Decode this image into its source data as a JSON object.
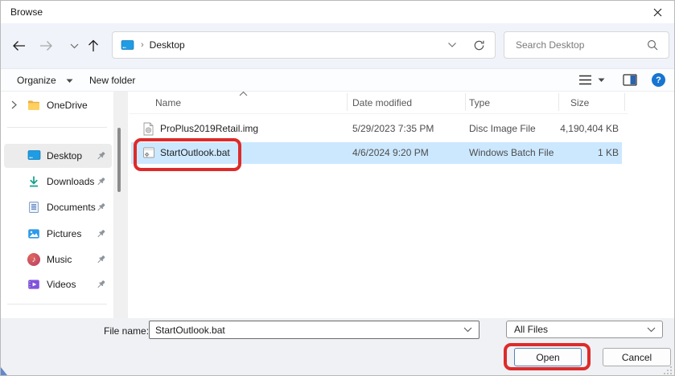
{
  "window": {
    "title": "Browse"
  },
  "toolbar": {
    "breadcrumb_root": "Desktop",
    "breadcrumb_separator": "›",
    "search_placeholder": "Search Desktop"
  },
  "command_bar": {
    "organize_label": "Organize",
    "new_folder_label": "New folder"
  },
  "sidebar": {
    "items": [
      {
        "label": "OneDrive",
        "icon": "folder-icon",
        "expandable": true
      },
      {
        "label": "Desktop",
        "icon": "desktop-icon",
        "selected": true,
        "pinned": true
      },
      {
        "label": "Downloads",
        "icon": "download-icon",
        "pinned": true
      },
      {
        "label": "Documents",
        "icon": "document-icon",
        "pinned": true
      },
      {
        "label": "Pictures",
        "icon": "pictures-icon",
        "pinned": true
      },
      {
        "label": "Music",
        "icon": "music-icon",
        "pinned": true,
        "note_glyph": "♪"
      },
      {
        "label": "Videos",
        "icon": "videos-icon",
        "pinned": true
      }
    ]
  },
  "file_list": {
    "columns": [
      "Name",
      "Date modified",
      "Type",
      "Size"
    ],
    "sort": {
      "column": "Name",
      "direction": "ascending"
    },
    "rows": [
      {
        "name": "ProPlus2019Retail.img",
        "date_modified": "5/29/2023 7:35 PM",
        "type": "Disc Image File",
        "size": "4,190,404 KB",
        "icon": "disc-image-file-icon",
        "selected": false
      },
      {
        "name": "StartOutlook.bat",
        "date_modified": "4/6/2024 9:20 PM",
        "type": "Windows Batch File",
        "size": "1 KB",
        "icon": "batch-file-icon",
        "selected": true,
        "annotated": true
      }
    ]
  },
  "footer": {
    "file_name_label": "File name:",
    "file_name_value": "StartOutlook.bat",
    "file_type_value": "All Files",
    "open_label": "Open",
    "cancel_label": "Cancel"
  },
  "icons": [
    "close-icon",
    "back-icon",
    "forward-icon",
    "recent-locations-icon",
    "up-icon",
    "refresh-icon",
    "address-chevron-icon",
    "search-icon",
    "organize-chevron-icon",
    "view-icon",
    "view-chevron-icon",
    "preview-pane-icon",
    "help-icon",
    "expand-chevron-icon",
    "pin-icon",
    "sort-ascending-icon",
    "combo-chevron-icon"
  ],
  "colors": {
    "selection_blue": "#cce8ff",
    "annotation_red": "#dd2b2b",
    "help_blue": "#1675d1",
    "toolbar_band": "#f1f3fa",
    "footer_band": "#eff1f4",
    "folder_yellow": "#ffd05e",
    "downloads_teal": "#12a089",
    "music_red": "#d9544f",
    "videos_purple": "#8152dd",
    "desktop_blue": "#1e9ce4"
  }
}
